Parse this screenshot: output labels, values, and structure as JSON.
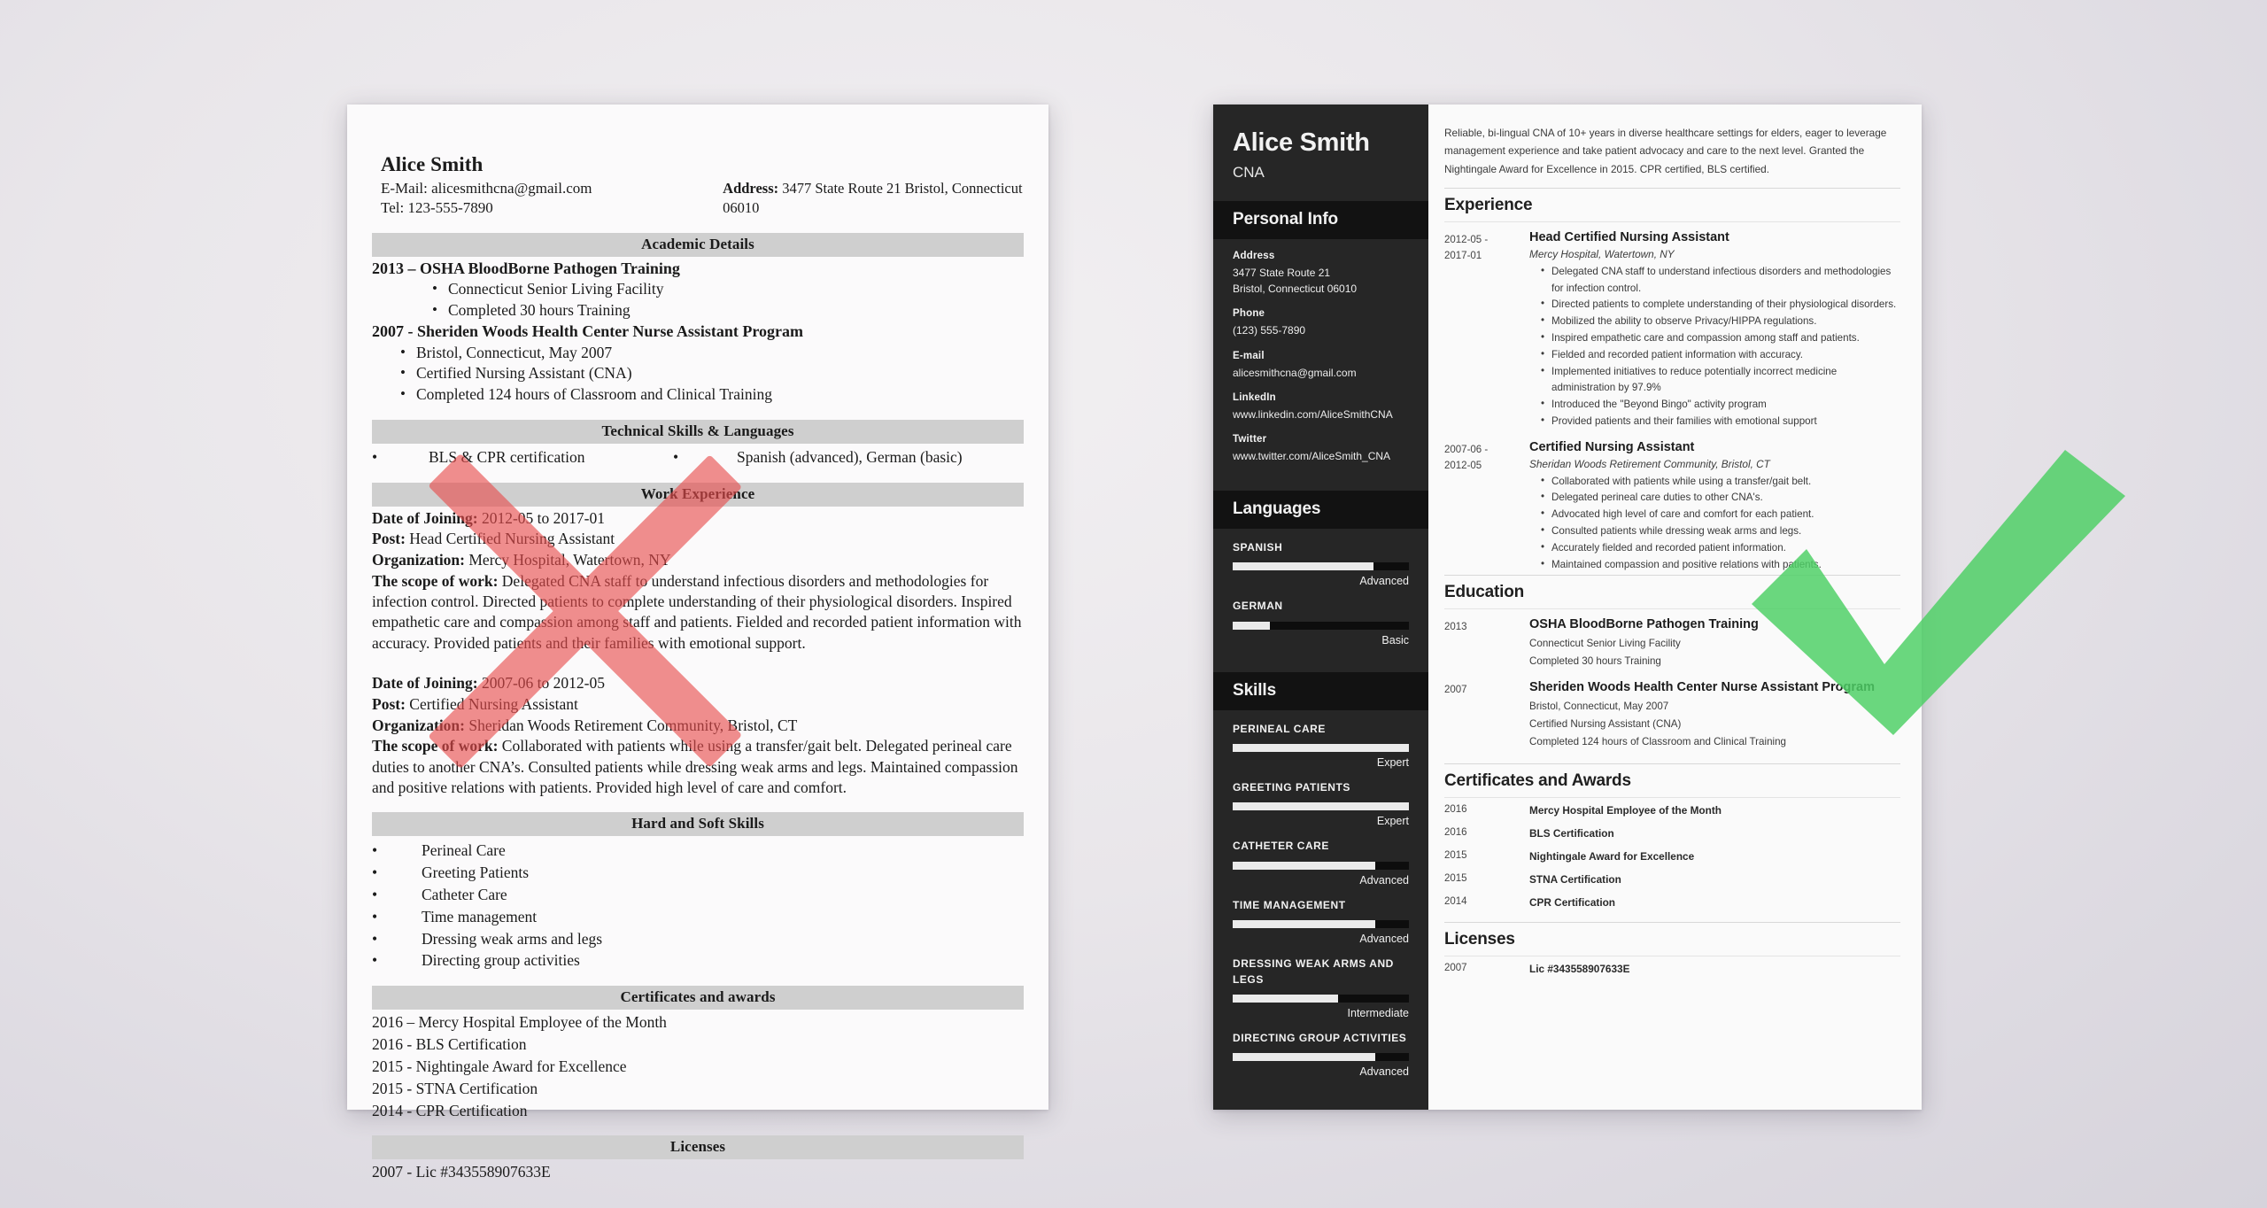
{
  "marks": {
    "reject": {
      "icon": "cross-mark-icon",
      "color": "#f08080"
    },
    "approve": {
      "icon": "check-mark-icon",
      "color": "#5fd271"
    }
  },
  "bad_resume": {
    "name": "Alice Smith",
    "email_line": "E-Mail: alicesmithcna@gmail.com",
    "tel_line": "Tel: 123-555-7890",
    "address_label": "Address:",
    "address_value": "3477 State Route 21 Bristol, Connecticut",
    "address_value2": "06010",
    "sections": {
      "academic": "Academic Details",
      "technical": "Technical Skills & Languages",
      "work": "Work Experience",
      "skills": "Hard and Soft Skills",
      "certificates": "Certificates and awards",
      "licenses": "Licenses"
    },
    "academic": [
      {
        "heading": "2013 – OSHA BloodBorne Pathogen Training",
        "bullets": [
          "Connecticut Senior Living Facility",
          "Completed 30 hours Training"
        ]
      },
      {
        "heading": "2007 - Sheriden Woods Health Center Nurse Assistant Program",
        "bullets": [
          "Bristol, Connecticut, May 2007",
          "Certified Nursing Assistant (CNA)",
          "Completed 124 hours of Classroom and Clinical Training"
        ]
      }
    ],
    "technical": {
      "left": "BLS & CPR certification",
      "right": "Spanish (advanced), German (basic)"
    },
    "work": [
      {
        "date_label": "Date of Joining:",
        "date_value": "2012-05 to 2017-01",
        "post_label": "Post:",
        "post_value": "Head Certified Nursing Assistant",
        "org_label": "Organization:",
        "org_value": "Mercy Hospital, Watertown, NY",
        "scope_label": "The scope of work:",
        "scope_value": "Delegated CNA staff to understand infectious disorders and methodologies for infection control. Directed patients to complete understanding of their physiological disorders. Inspired empathetic care and compassion among staff and patients. Fielded and recorded patient information with accuracy. Provided patients and their families with emotional support."
      },
      {
        "date_label": "Date of Joining:",
        "date_value": "2007-06 to 2012-05",
        "post_label": "Post:",
        "post_value": "Certified Nursing Assistant",
        "org_label": "Organization:",
        "org_value": "Sheridan Woods Retirement Community, Bristol, CT",
        "scope_label": "The scope of work:",
        "scope_value": "Collaborated with patients while using a transfer/gait belt. Delegated perineal care duties to another CNA’s. Consulted patients while dressing weak arms and legs. Maintained compassion and positive relations with patients. Provided high level of care and comfort."
      }
    ],
    "hard_soft_skills": [
      "Perineal Care",
      "Greeting Patients",
      "Catheter Care",
      "Time management",
      "Dressing weak arms and legs",
      "Directing group activities"
    ],
    "certificates": [
      "2016 – Mercy Hospital Employee of the Month",
      "2016 - BLS Certification",
      "2015 - Nightingale Award for Excellence",
      "2015 - STNA Certification",
      "2014 - CPR Certification"
    ],
    "licenses": [
      "2007 - Lic #343558907633E"
    ]
  },
  "good_resume": {
    "sidebar": {
      "name": "Alice Smith",
      "title": "CNA",
      "personal_info_heading": "Personal Info",
      "fields": [
        {
          "label": "Address",
          "value": "3477 State Route 21\nBristol, Connecticut 06010"
        },
        {
          "label": "Phone",
          "value": "(123) 555-7890"
        },
        {
          "label": "E-mail",
          "value": "alicesmithcna@gmail.com"
        },
        {
          "label": "LinkedIn",
          "value": "www.linkedin.com/AliceSmithCNA"
        },
        {
          "label": "Twitter",
          "value": "www.twitter.com/AliceSmith_CNA"
        }
      ],
      "languages_heading": "Languages",
      "languages": [
        {
          "label": "SPANISH",
          "level": "Advanced",
          "pct": 80
        },
        {
          "label": "GERMAN",
          "level": "Basic",
          "pct": 21
        }
      ],
      "skills_heading": "Skills",
      "skills": [
        {
          "label": "PERINEAL CARE",
          "level": "Expert",
          "pct": 100
        },
        {
          "label": "GREETING PATIENTS",
          "level": "Expert",
          "pct": 100
        },
        {
          "label": "CATHETER CARE",
          "level": "Advanced",
          "pct": 81
        },
        {
          "label": "TIME MANAGEMENT",
          "level": "Advanced",
          "pct": 81
        },
        {
          "label": "DRESSING WEAK ARMS AND LEGS",
          "level": "Intermediate",
          "pct": 60
        },
        {
          "label": "DIRECTING GROUP ACTIVITIES",
          "level": "Advanced",
          "pct": 81
        }
      ]
    },
    "main": {
      "summary": "Reliable, bi-lingual CNA of 10+ years in diverse healthcare settings for elders, eager to leverage management experience and take patient advocacy and care to the next level. Granted the Nightingale Award for Excellence in 2015. CPR certified, BLS certified.",
      "experience_heading": "Experience",
      "experience": [
        {
          "dates": "2012-05 -\n2017-01",
          "role": "Head Certified Nursing Assistant",
          "org": "Mercy Hospital, Watertown, NY",
          "bullets": [
            "Delegated CNA staff to understand infectious disorders and methodologies for infection control.",
            "Directed patients to complete understanding of their physiological disorders.",
            "Mobilized the ability to observe Privacy/HIPPA regulations.",
            "Inspired empathetic care and compassion among staff and patients.",
            "Fielded and recorded patient information with accuracy.",
            "Implemented initiatives to reduce potentially incorrect medicine administration by 97.9%",
            "Introduced the \"Beyond Bingo\" activity program",
            "Provided patients and their families with emotional support"
          ]
        },
        {
          "dates": "2007-06 -\n2012-05",
          "role": "Certified Nursing Assistant",
          "org": "Sheridan Woods Retirement Community, Bristol, CT",
          "bullets": [
            "Collaborated with patients while using a transfer/gait belt.",
            "Delegated perineal care duties to other CNA's.",
            "Advocated high level of care and comfort for each patient.",
            "Consulted patients while dressing weak arms and legs.",
            "Accurately fielded and recorded patient information.",
            "Maintained compassion and positive relations with patients."
          ]
        }
      ],
      "education_heading": "Education",
      "education": [
        {
          "dates": "2013",
          "role": "OSHA BloodBorne Pathogen Training",
          "details": [
            "Connecticut Senior Living Facility",
            "Completed 30 hours Training"
          ]
        },
        {
          "dates": "2007",
          "role": "Sheriden Woods Health Center Nurse Assistant Program",
          "details": [
            "Bristol, Connecticut, May 2007",
            "Certified Nursing Assistant (CNA)",
            "Completed 124 hours of Classroom and Clinical Training"
          ]
        }
      ],
      "certificates_heading": "Certificates and Awards",
      "certificates": [
        {
          "year": "2016",
          "text": "Mercy Hospital Employee of the Month"
        },
        {
          "year": "2016",
          "text": "BLS Certification"
        },
        {
          "year": "2015",
          "text": "Nightingale Award for Excellence"
        },
        {
          "year": "2015",
          "text": "STNA Certification"
        },
        {
          "year": "2014",
          "text": "CPR Certification"
        }
      ],
      "licenses_heading": "Licenses",
      "licenses": [
        {
          "year": "2007",
          "text": "Lic #343558907633E"
        }
      ]
    }
  }
}
